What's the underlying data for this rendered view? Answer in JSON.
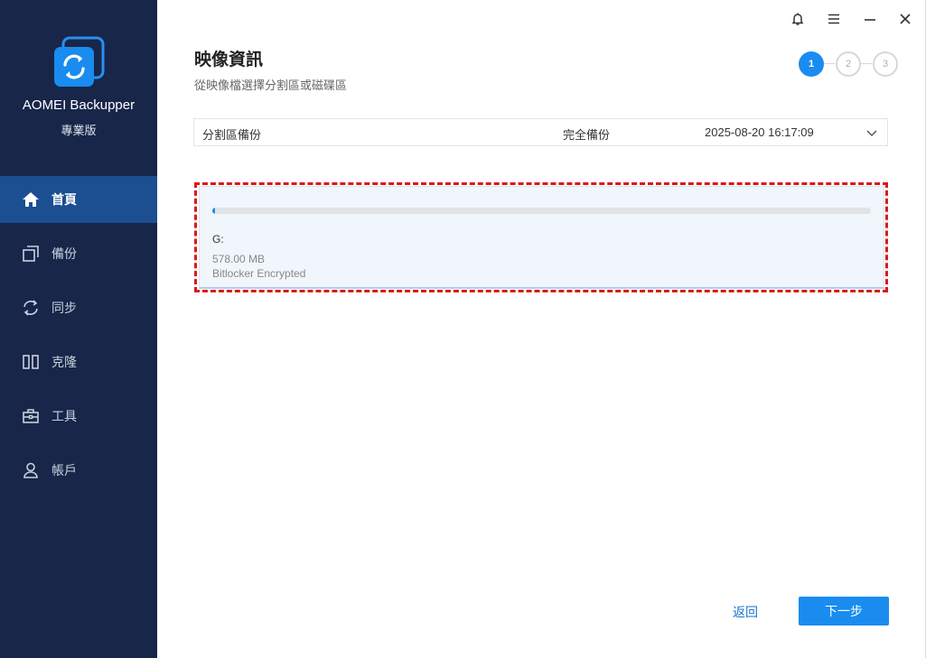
{
  "app": {
    "name": "AOMEI Backupper",
    "edition": "專業版",
    "logo_icon": "sync-logo-icon",
    "brand_color": "#1a8cf0",
    "sidebar_bg": "#172649",
    "sidebar_active_bg": "#1b4f91"
  },
  "window_controls": [
    {
      "name": "notification",
      "icon": "bell-icon"
    },
    {
      "name": "menu",
      "icon": "hamburger-menu-icon"
    },
    {
      "name": "minimize",
      "icon": "minimize-icon"
    },
    {
      "name": "close",
      "icon": "close-icon"
    }
  ],
  "sidebar": {
    "items": [
      {
        "label": "首頁",
        "icon": "home-icon",
        "active": true
      },
      {
        "label": "備份",
        "icon": "backup-copy-icon",
        "active": false
      },
      {
        "label": "同步",
        "icon": "sync-icon",
        "active": false
      },
      {
        "label": "克隆",
        "icon": "clone-icon",
        "active": false
      },
      {
        "label": "工具",
        "icon": "toolbox-icon",
        "active": false
      },
      {
        "label": "帳戶",
        "icon": "user-icon",
        "active": false
      }
    ]
  },
  "page": {
    "title": "映像資訊",
    "subtitle": "從映像檔選擇分割區或磁碟區"
  },
  "steps": [
    {
      "label": "1",
      "state": "current"
    },
    {
      "label": "2",
      "state": "pending"
    },
    {
      "label": "3",
      "state": "pending"
    }
  ],
  "image_select": {
    "backup_type": "分割區備份",
    "backup_mode": "完全備份",
    "timestamp": "2025-08-20 16:17:09",
    "icon": "chevron-down-icon"
  },
  "partition": {
    "letter": "G:",
    "size": "578.00 MB",
    "filesystem": "Bitlocker Encrypted",
    "used_fraction": 0.004,
    "selected": true,
    "highlight_color": "#e0151c"
  },
  "buttons": {
    "back": "返回",
    "next": "下一步"
  }
}
